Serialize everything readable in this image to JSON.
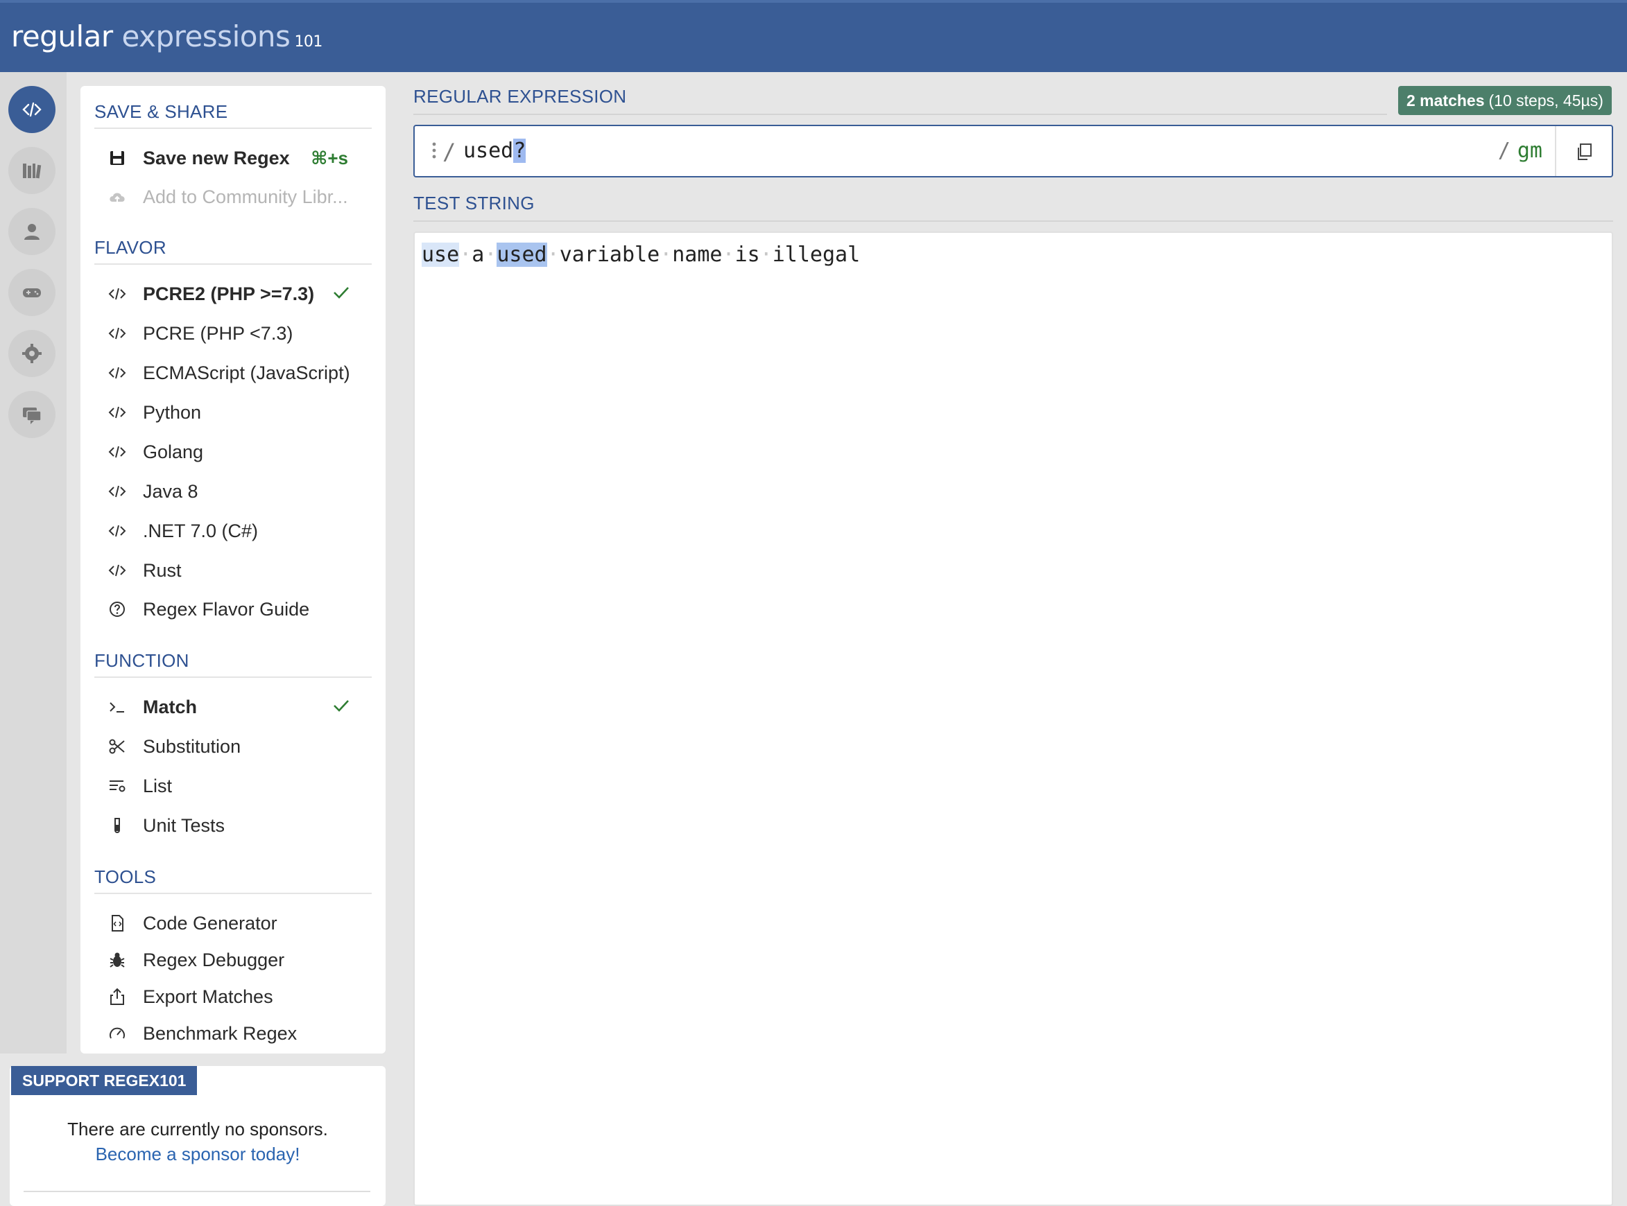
{
  "header": {
    "brand_main": "regular",
    "brand_light": "expressions",
    "brand_version": "101"
  },
  "rail": [
    "code-icon",
    "library-icon",
    "user-icon",
    "gamepad-icon",
    "settings-icon",
    "chat-icon"
  ],
  "save_share": {
    "title": "SAVE & SHARE",
    "save_label": "Save new Regex",
    "save_shortcut": "⌘+s",
    "community_label": "Add to Community Libr..."
  },
  "flavor": {
    "title": "FLAVOR",
    "items": [
      "PCRE2 (PHP >=7.3)",
      "PCRE (PHP <7.3)",
      "ECMAScript (JavaScript)",
      "Python",
      "Golang",
      "Java 8",
      ".NET 7.0 (C#)",
      "Rust"
    ],
    "selected": "PCRE2 (PHP >=7.3)",
    "guide": "Regex Flavor Guide"
  },
  "function": {
    "title": "FUNCTION",
    "items": [
      "Match",
      "Substitution",
      "List",
      "Unit Tests"
    ],
    "selected": "Match"
  },
  "tools": {
    "title": "TOOLS",
    "items": [
      "Code Generator",
      "Regex Debugger",
      "Export Matches",
      "Benchmark Regex"
    ]
  },
  "support": {
    "tag": "SUPPORT REGEX101",
    "text": "There are currently no sponsors.",
    "link": "Become a sponsor today!"
  },
  "regex": {
    "label": "REGULAR EXPRESSION",
    "delimiter": "/",
    "pattern_plain": "used",
    "pattern_highlight": "?",
    "flags": "gm",
    "matches_count": "2 matches",
    "matches_detail": "(10 steps, 45µs)"
  },
  "test": {
    "label": "TEST STRING",
    "words": [
      "use",
      "a",
      "used",
      "variable",
      "name",
      "is",
      "illegal"
    ]
  },
  "colors": {
    "header": "#3a5d96",
    "accent": "#2e5191",
    "match_badge": "#4c7f6a",
    "check": "#2e7d32"
  }
}
